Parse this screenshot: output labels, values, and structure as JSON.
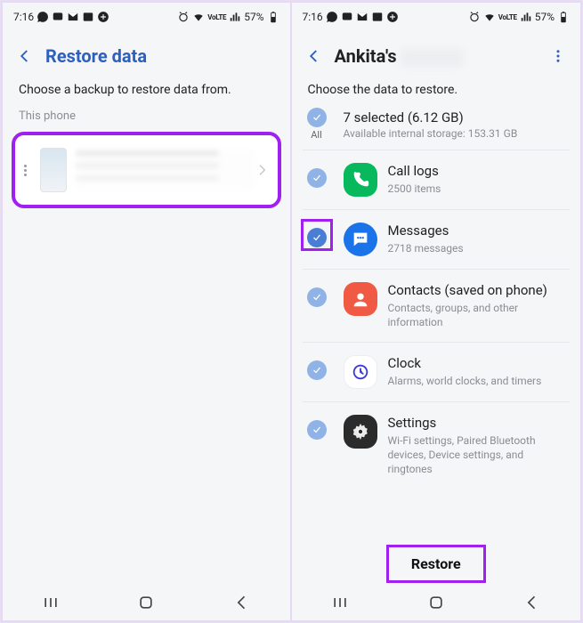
{
  "statusbar": {
    "time": "7:16",
    "battery": "57%"
  },
  "left": {
    "title": "Restore data",
    "subtitle": "Choose a backup to restore data from.",
    "section": "This phone"
  },
  "right": {
    "owner": "Ankita's",
    "subtitle": "Choose the data to restore.",
    "summary_main": "7 selected (6.12 GB)",
    "summary_sub": "Available internal storage: 153.31 GB",
    "all_label": "All",
    "items": [
      {
        "title": "Call logs",
        "sub": "2500 items"
      },
      {
        "title": "Messages",
        "sub": "2718 messages"
      },
      {
        "title": "Contacts (saved on phone)",
        "sub": "Contacts, groups, and other information"
      },
      {
        "title": "Clock",
        "sub": "Alarms, world clocks, and timers"
      },
      {
        "title": "Settings",
        "sub": "Wi-Fi settings, Paired Bluetooth devices, Device settings, and ringtones"
      }
    ],
    "restore": "Restore"
  }
}
